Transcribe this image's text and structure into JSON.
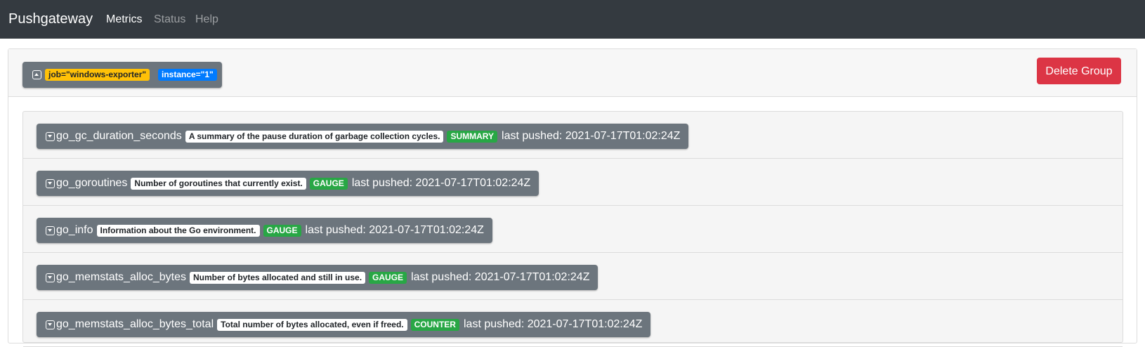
{
  "navbar": {
    "brand": "Pushgateway",
    "links": [
      {
        "label": "Metrics",
        "active": true
      },
      {
        "label": "Status",
        "active": false
      },
      {
        "label": "Help",
        "active": false
      }
    ]
  },
  "group": {
    "labels": {
      "job": "job=\"windows-exporter\"",
      "instance": "instance=\"1\""
    },
    "delete_label": "Delete Group",
    "colors": {
      "job": "#ffc107",
      "instance": "#007bff",
      "delete": "#dc3545",
      "type": "#28a745"
    }
  },
  "metrics": [
    {
      "name": "go_gc_duration_seconds",
      "help": "A summary of the pause duration of garbage collection cycles.",
      "type": "SUMMARY",
      "pushed": "last pushed: 2021-07-17T01:02:24Z"
    },
    {
      "name": "go_goroutines",
      "help": "Number of goroutines that currently exist.",
      "type": "GAUGE",
      "pushed": "last pushed: 2021-07-17T01:02:24Z"
    },
    {
      "name": "go_info",
      "help": "Information about the Go environment.",
      "type": "GAUGE",
      "pushed": "last pushed: 2021-07-17T01:02:24Z"
    },
    {
      "name": "go_memstats_alloc_bytes",
      "help": "Number of bytes allocated and still in use.",
      "type": "GAUGE",
      "pushed": "last pushed: 2021-07-17T01:02:24Z"
    },
    {
      "name": "go_memstats_alloc_bytes_total",
      "help": "Total number of bytes allocated, even if freed.",
      "type": "COUNTER",
      "pushed": "last pushed: 2021-07-17T01:02:24Z"
    }
  ]
}
